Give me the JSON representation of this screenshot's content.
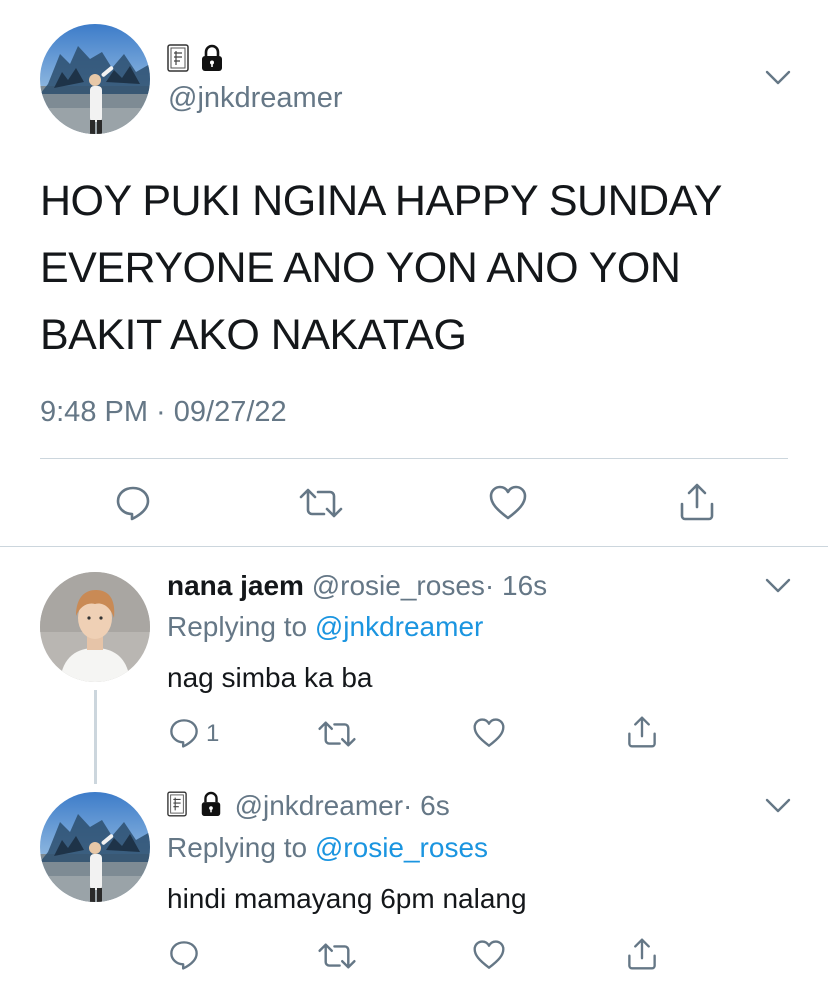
{
  "main_tweet": {
    "handle": "@jnkdreamer",
    "text_lines": [
      "HOY PUKI NGINA HAPPY SUNDAY",
      "EVERYONE ANO YON ANO YON",
      "BAKIT AKO NAKATAG"
    ],
    "timestamp": "9:48 PM · 09/27/22"
  },
  "reply1": {
    "name": "nana jaem",
    "handle": "@rosie_roses",
    "time": "· 16s",
    "replying_prefix": "Replying to",
    "replying_handle": "@jnkdreamer",
    "text": "nag simba ka ba",
    "reply_count": "1"
  },
  "reply2": {
    "handle": "@jnkdreamer",
    "time": "· 6s",
    "replying_prefix": "Replying to",
    "replying_handle": "@rosie_roses",
    "text": "hindi mamayang 6pm nalang"
  },
  "icons": {
    "reply": "speech-bubble-icon",
    "retweet": "retweet-icon",
    "like": "heart-icon",
    "share": "share-icon",
    "more": "chevron-down-icon",
    "lock": "lock-icon",
    "name_emoji": "playing-card-icon"
  },
  "colors": {
    "text": "#14171a",
    "secondary": "#657786",
    "link": "#1b95e0",
    "divider": "#ccd6dd"
  }
}
